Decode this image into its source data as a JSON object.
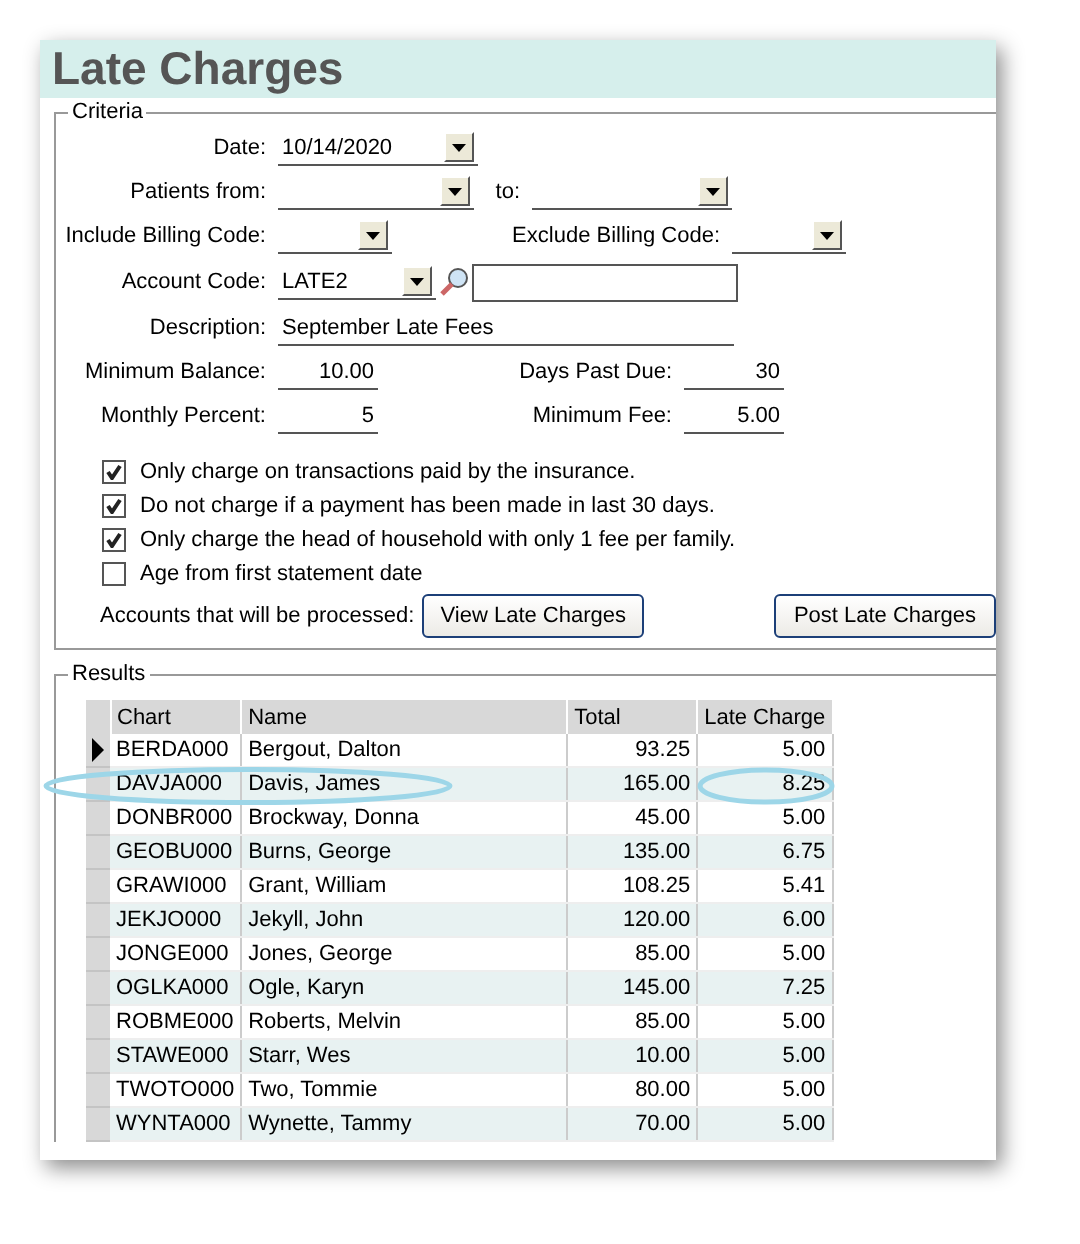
{
  "window": {
    "title": "Late Charges"
  },
  "criteria": {
    "title": "Criteria",
    "date": {
      "label": "Date:",
      "value": "10/14/2020"
    },
    "patients_from": {
      "label": "Patients from:"
    },
    "patients_to": {
      "label": "to:"
    },
    "include_billing": {
      "label": "Include Billing Code:"
    },
    "exclude_billing": {
      "label": "Exclude Billing Code:"
    },
    "account_code": {
      "label": "Account Code:",
      "value": "LATE2"
    },
    "description": {
      "label": "Description:",
      "value": "September Late Fees"
    },
    "minimum_balance": {
      "label": "Minimum Balance:",
      "value": "10.00"
    },
    "days_past_due": {
      "label": "Days Past Due:",
      "value": "30"
    },
    "monthly_percent": {
      "label": "Monthly Percent:",
      "value": "5"
    },
    "minimum_fee": {
      "label": "Minimum Fee:",
      "value": "5.00"
    },
    "options": [
      {
        "label": "Only charge on transactions paid by the insurance.",
        "checked": true
      },
      {
        "label": "Do not charge if a payment has been made in last 30 days.",
        "checked": true
      },
      {
        "label": "Only charge the head of household with only 1 fee per family.",
        "checked": true
      },
      {
        "label": "Age from first statement date",
        "checked": false
      }
    ],
    "accounts_label": "Accounts that will be processed:",
    "buttons": [
      "View Late Charges",
      "Post Late Charges"
    ]
  },
  "results": {
    "title": "Results",
    "columns": [
      "Chart",
      "Name",
      "Total",
      "Late Charge"
    ],
    "rows": [
      {
        "cells": [
          "BERDA000",
          "Bergout, Dalton",
          "93.25",
          "5.00"
        ],
        "current": true
      },
      {
        "cells": [
          "DAVJA000",
          "Davis, James",
          "165.00",
          "8.25"
        ],
        "current": false
      },
      {
        "cells": [
          "DONBR000",
          "Brockway, Donna",
          "45.00",
          "5.00"
        ],
        "current": false
      },
      {
        "cells": [
          "GEOBU000",
          "Burns, George",
          "135.00",
          "6.75"
        ],
        "current": false
      },
      {
        "cells": [
          "GRAWI000",
          "Grant, William",
          "108.25",
          "5.41"
        ],
        "current": false
      },
      {
        "cells": [
          "JEKJO000",
          "Jekyll, John",
          "120.00",
          "6.00"
        ],
        "current": false
      },
      {
        "cells": [
          "JONGE000",
          "Jones, George",
          "85.00",
          "5.00"
        ],
        "current": false
      },
      {
        "cells": [
          "OGLKA000",
          "Ogle, Karyn",
          "145.00",
          "7.25"
        ],
        "current": false
      },
      {
        "cells": [
          "ROBME000",
          "Roberts, Melvin",
          "85.00",
          "5.00"
        ],
        "current": false
      },
      {
        "cells": [
          "STAWE000",
          "Starr, Wes",
          "10.00",
          "5.00"
        ],
        "current": false
      },
      {
        "cells": [
          "TWOTO000",
          "Two, Tommie",
          "80.00",
          "5.00"
        ],
        "current": false
      },
      {
        "cells": [
          "WYNTA000",
          "Wynette, Tammy",
          "70.00",
          "5.00"
        ],
        "current": false
      }
    ]
  }
}
